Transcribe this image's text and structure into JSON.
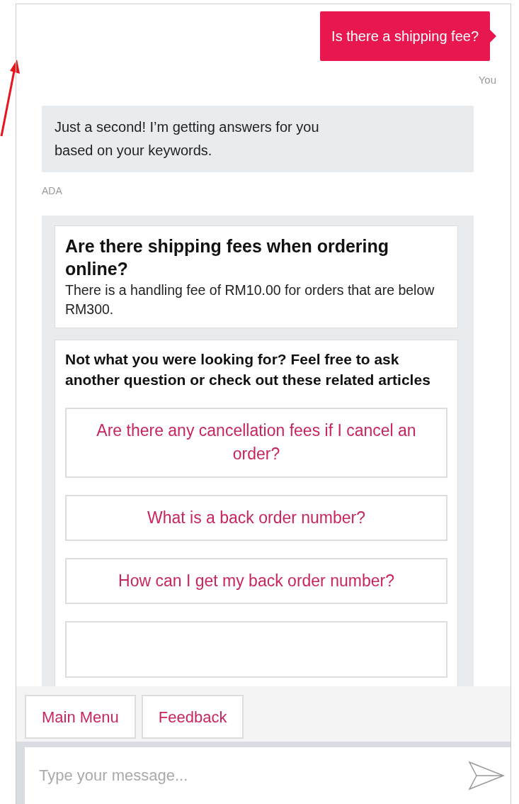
{
  "user_message": {
    "text": "Is there a shipping fee?",
    "sender": "You"
  },
  "bot_message": {
    "text": "Just a second! I’m getting answers for you based on your keywords.",
    "sender": "ADA"
  },
  "answer_card": {
    "title": "Are there shipping fees when ordering online?",
    "body": "There is a handling fee of RM10.00 for orders that are below RM300."
  },
  "related": {
    "heading": "Not what you were looking for? Feel free to ask another question or check out these related articles",
    "articles": [
      "Are there any cancellation fees if I cancel an order?",
      "What is a back order number?",
      "How can I get my back order number?"
    ]
  },
  "quick_replies": [
    "Main Menu",
    "Feedback"
  ],
  "input": {
    "placeholder": "Type your message..."
  }
}
